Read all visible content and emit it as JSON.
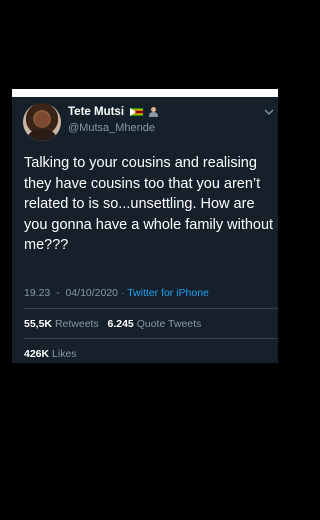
{
  "tweet": {
    "display_name": "Tete Mutsi",
    "handle": "@Mutsa_Mhende",
    "name_emoji_icons": [
      "zimbabwe-flag-icon",
      "person-at-laptop-icon"
    ],
    "text": "Talking to your cousins and realising they have cousins too that you aren’t related to is so...unsettling. How are you gonna have a whole family without me???",
    "time": "19.23",
    "date": "04/10/2020",
    "separator": "·",
    "source": "Twitter for iPhone",
    "retweets_count": "55,5K",
    "retweets_label": "Retweets",
    "quote_tweets_count": "6.245",
    "quote_tweets_label": "Quote Tweets",
    "likes_count": "426K",
    "likes_label": "Likes"
  },
  "colors": {
    "background": "#000000",
    "card": "#15202b",
    "text": "#ffffff",
    "secondary_text": "#8899a6",
    "link": "#1da1f2",
    "divider": "#38444d"
  }
}
